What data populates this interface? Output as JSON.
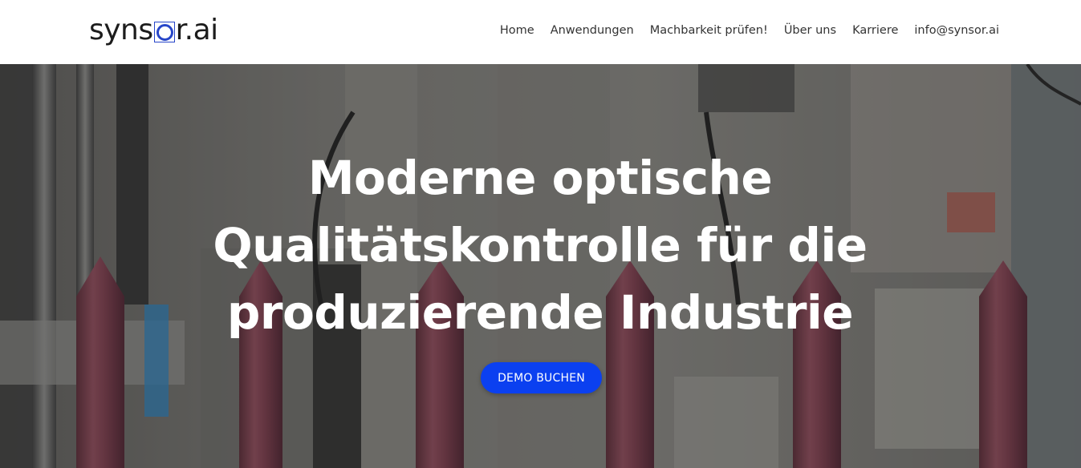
{
  "header": {
    "logo": {
      "prefix": "syns",
      "mark_icon": "square-o-logo-icon",
      "suffix": "r.ai",
      "accent_color": "#2746c9"
    },
    "nav": [
      {
        "label": "Home"
      },
      {
        "label": "Anwendungen"
      },
      {
        "label": "Machbarkeit prüfen!"
      },
      {
        "label": "Über uns"
      },
      {
        "label": "Karriere"
      },
      {
        "label": "info@synsor.ai"
      }
    ]
  },
  "hero": {
    "title_lines": [
      "Moderne optische",
      "Qualitätskontrolle für die",
      "produzierende Industrie"
    ],
    "cta_label": "DEMO BUCHEN",
    "cta_color": "#0b40f0",
    "background_image": "industrial-production-line-lipsticks"
  }
}
